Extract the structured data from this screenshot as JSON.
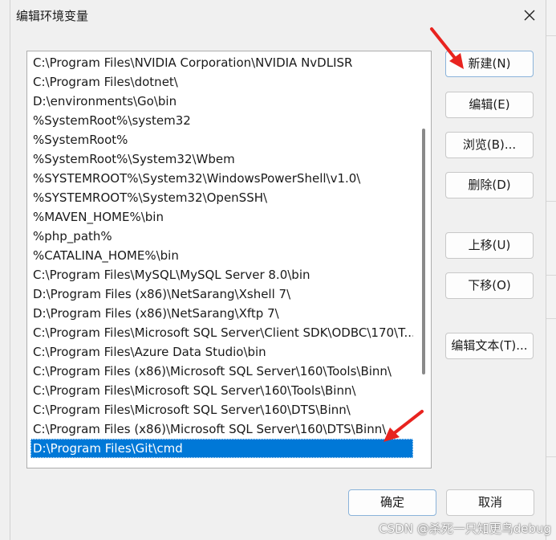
{
  "window": {
    "title": "编辑环境变量"
  },
  "path_list": {
    "items": [
      "C:\\Program Files\\NVIDIA Corporation\\NVIDIA NvDLISR",
      "C:\\Program Files\\dotnet\\",
      "D:\\environments\\Go\\bin",
      "%SystemRoot%\\system32",
      "%SystemRoot%",
      "%SystemRoot%\\System32\\Wbem",
      "%SYSTEMROOT%\\System32\\WindowsPowerShell\\v1.0\\",
      "%SYSTEMROOT%\\System32\\OpenSSH\\",
      "%MAVEN_HOME%\\bin",
      "%php_path%",
      "%CATALINA_HOME%\\bin",
      "C:\\Program Files\\MySQL\\MySQL Server 8.0\\bin",
      "D:\\Program Files (x86)\\NetSarang\\Xshell 7\\",
      "D:\\Program Files (x86)\\NetSarang\\Xftp 7\\",
      "C:\\Program Files\\Microsoft SQL Server\\Client SDK\\ODBC\\170\\T...",
      "C:\\Program Files\\Azure Data Studio\\bin",
      "C:\\Program Files (x86)\\Microsoft SQL Server\\160\\Tools\\Binn\\",
      "C:\\Program Files\\Microsoft SQL Server\\160\\Tools\\Binn\\",
      "C:\\Program Files\\Microsoft SQL Server\\160\\DTS\\Binn\\",
      "C:\\Program Files (x86)\\Microsoft SQL Server\\160\\DTS\\Binn\\",
      "D:\\Program Files\\Git\\cmd"
    ],
    "selected_index": 20,
    "scroll_position": 0.45
  },
  "buttons": {
    "new": "新建(N)",
    "edit": "编辑(E)",
    "browse": "浏览(B)...",
    "delete": "删除(D)",
    "move_up": "上移(U)",
    "move_down": "下移(O)",
    "edit_text": "编辑文本(T)...",
    "ok": "确定",
    "cancel": "取消"
  },
  "watermark": "CSDN @杀死一只知更鸟debug",
  "colors": {
    "selection": "#0078d7",
    "annotation_arrow": "#e8231f"
  }
}
